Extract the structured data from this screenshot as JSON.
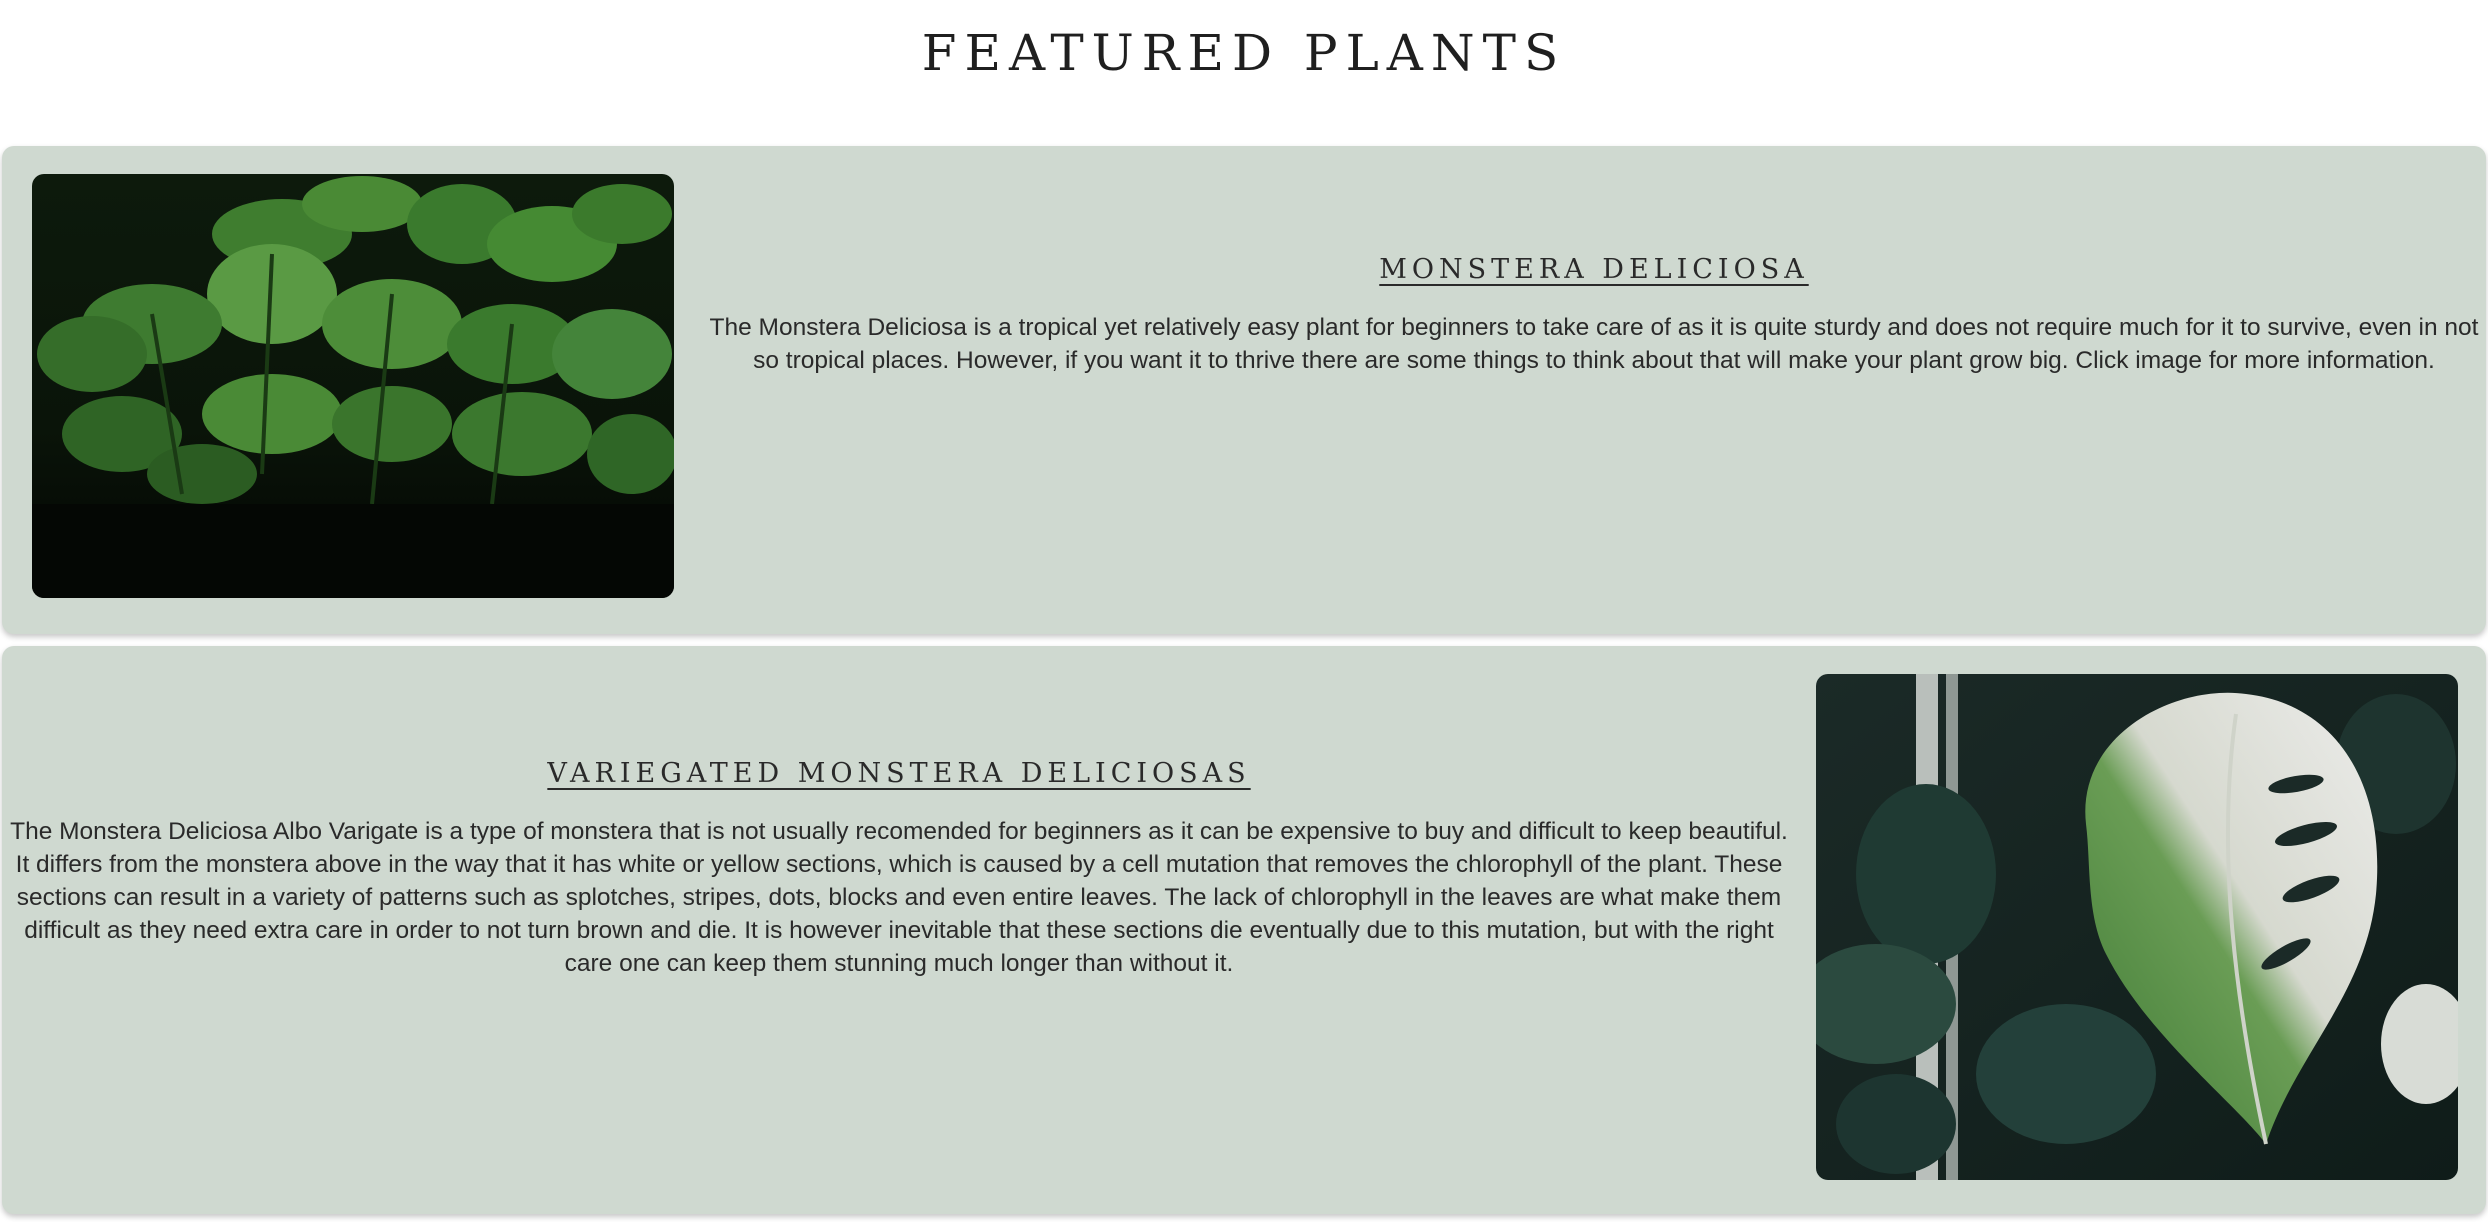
{
  "header": {
    "title": "FEATURED PLANTS"
  },
  "plants": [
    {
      "name": "MONSTERA DELICIOSA",
      "description": "The Monstera Deliciosa is a tropical yet relatively easy plant for beginners to take care of as it is quite sturdy and does not require much for it to survive, even in not so tropical places. However, if you want it to thrive there are some things to think about that will make your plant grow big. Click image for more information."
    },
    {
      "name": "VARIEGATED MONSTERA DELICIOSAS",
      "description": "The Monstera Deliciosa Albo Varigate is a type of monstera that is not usually recomended for beginners as it can be expensive to buy and difficult to keep beautiful. It differs from the monstera above in the way that it has white or yellow sections, which is caused by a cell mutation that removes the chlorophyll of the plant. These sections can result in a variety of patterns such as splotches, stripes, dots, blocks and even entire leaves. The lack of chlorophyll in the leaves are what make them difficult as they need extra care in order to not turn brown and die. It is however inevitable that these sections die eventually due to this mutation, but with the right care one can keep them stunning much longer than without it."
    }
  ],
  "colors": {
    "card_background": "#cfd9d0",
    "text": "#2a2a2a"
  }
}
